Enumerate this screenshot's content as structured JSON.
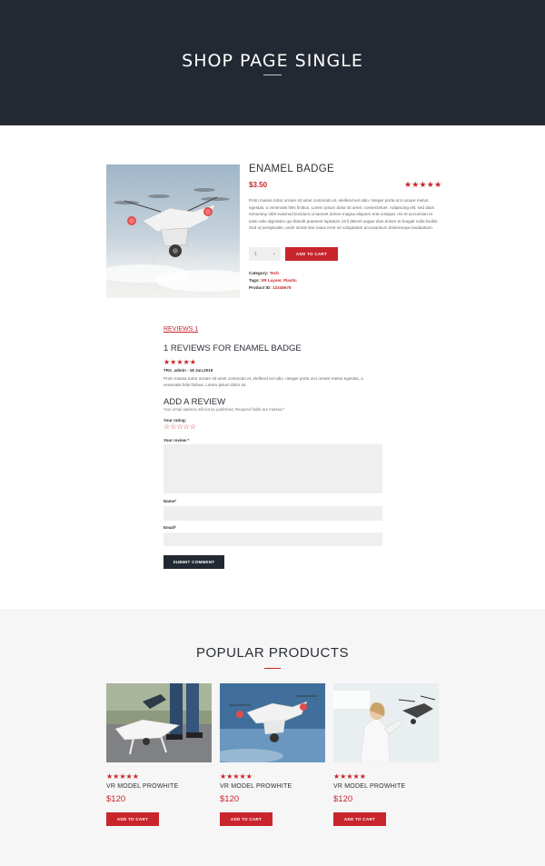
{
  "hero": {
    "title": "SHOP PAGE SINGLE"
  },
  "product": {
    "title": "ENAMEL BADGE",
    "price": "$3.50",
    "stars": "★★★★★",
    "description": "Proin massa tortor ornare sit amet commodo et, eleifend vel odio. Integer porta orci ornare metus egestas, a venenatis felis finibus. Lorem ipsum dolor sit amet, consectetuer. Adipiscing elit, sed diam nonummy nibh euismod tincidunt ut laoreet dolore magna aliquam erat volutpat. ms et accumsan et iusto odio dignissim qui blandit praesent luptatum zzril delenit augue duis dolore te feugait nulla facilisi. Sed ut perspiciatis, unde omnis iste natus error sit voluptatem accusantium doloremque laudantium.",
    "quantity": "1",
    "add_to_cart": "ADD TO CART",
    "meta": {
      "category_label": "Category: ",
      "category_value": "Tech",
      "tags_label": "Tags: ",
      "tags_value": "VR Layser, Plastic",
      "id_label": "Product ID: ",
      "id_value": "12345678"
    }
  },
  "reviews": {
    "tab_label": "REVIEWS 1",
    "heading": "1 REVIEWS FOR ENAMEL BADGE",
    "review": {
      "stars": "★★★★★",
      "author": "TRX_admin - 18 Jun,2019",
      "text": "Proin massa tortor ornare sit amet commodo et, eleifend vel odio. Integer porta orci ornare metus egestas, a venenatis felis finibus. Lorem ipsum dolor sit."
    },
    "form": {
      "heading": "ADD A REVIEW",
      "note": "Your email address will not be published. Required fields are marked *",
      "rating_label": "Your rating:",
      "rating_stars": "☆☆☆☆☆",
      "review_label": "Your review *",
      "name_label": "Name*",
      "email_label": "Email*",
      "submit_label": "SUBMIT COMMENT"
    }
  },
  "popular": {
    "title": "POPULAR PRODUCTS",
    "items": [
      {
        "stars": "★★★★★",
        "name": "VR MODEL PROWHITE",
        "price": "$120",
        "button": "ADD TO CART"
      },
      {
        "stars": "★★★★★",
        "name": "VR MODEL PROWHITE",
        "price": "$120",
        "button": "ADD TO CART"
      },
      {
        "stars": "★★★★★",
        "name": "VR MODEL PROWHITE",
        "price": "$120",
        "button": "ADD TO CART"
      }
    ]
  },
  "colors": {
    "accent": "#c9252c",
    "dark": "#232932",
    "light_bg": "#f6f6f6",
    "field_bg": "#efefef"
  }
}
